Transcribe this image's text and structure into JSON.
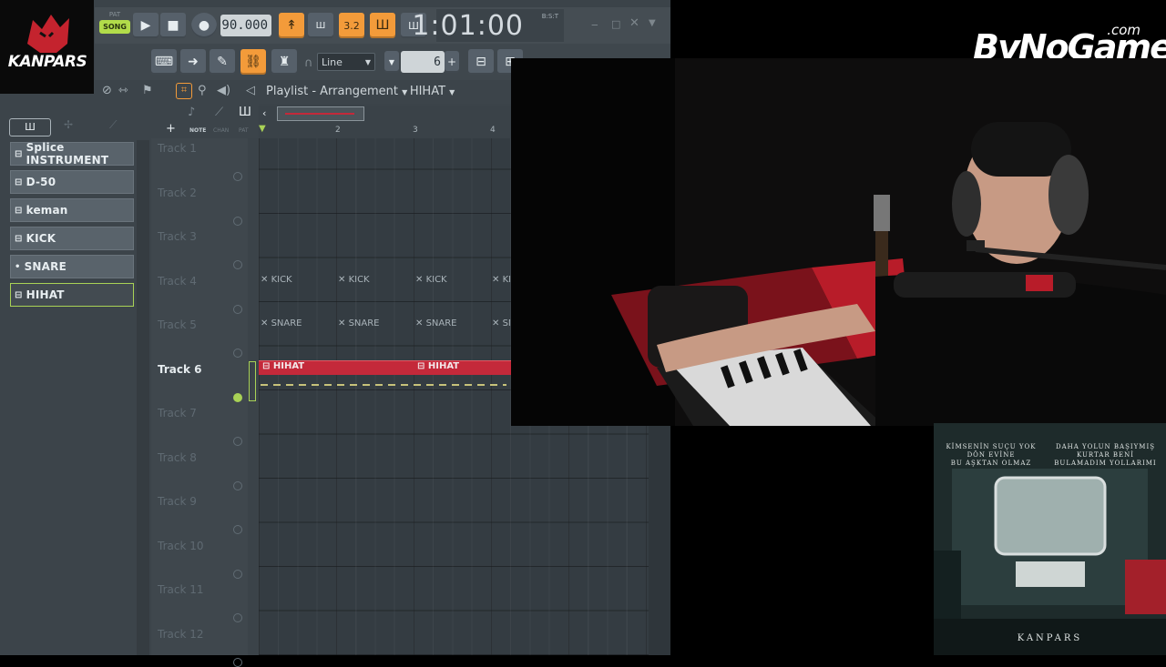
{
  "logo": {
    "text": "KANPARS"
  },
  "watermark": {
    "brand": "ByNoGame",
    "suffix": ".com"
  },
  "transport": {
    "mode_top": "PAT",
    "mode_bottom": "SONG",
    "tempo": "90.000",
    "time": "1:01:00",
    "time_label": "B:S:T",
    "btn_pattern_num": "3.2",
    "snap": "Line",
    "step": "6"
  },
  "playlist": {
    "title": "Playlist - Arrangement",
    "pattern": "HIHAT",
    "col_labels": [
      "NOTE",
      "CHAN",
      "PAT"
    ],
    "ruler": [
      "2",
      "3",
      "4"
    ]
  },
  "picker": {
    "items": [
      {
        "label": "Splice INSTRUMENT",
        "icon": "grid"
      },
      {
        "label": "D-50",
        "icon": "grid"
      },
      {
        "label": "keman",
        "icon": "grid"
      },
      {
        "label": "KICK",
        "icon": "grid"
      },
      {
        "label": "SNARE",
        "icon": "dot"
      },
      {
        "label": "HIHAT",
        "icon": "grid",
        "selected": true
      }
    ]
  },
  "tracks": [
    {
      "name": "Track 1"
    },
    {
      "name": "Track 2"
    },
    {
      "name": "Track 3"
    },
    {
      "name": "Track 4"
    },
    {
      "name": "Track 5"
    },
    {
      "name": "Track 6",
      "active": true
    },
    {
      "name": "Track 7"
    },
    {
      "name": "Track 8"
    },
    {
      "name": "Track 9"
    },
    {
      "name": "Track 10"
    },
    {
      "name": "Track 11"
    },
    {
      "name": "Track 12"
    }
  ],
  "clips": {
    "kick": "KICK",
    "snare": "SNARE",
    "hihat": "HIHAT"
  },
  "album": {
    "line_left": [
      "KİMSENİN SUÇU YOK",
      "DÖN EVİNE",
      "BU AŞKTAN OLMAZ"
    ],
    "line_right": [
      "DAHA YOLUN BAŞIYMIŞ",
      "KURTAR BENİ",
      "BULAMADIM YOLLARIMI"
    ],
    "artist": "KANPARS"
  },
  "colors": {
    "accent": "#f39b3a",
    "select": "#a9d256",
    "clip": "#c4293a",
    "logo_red": "#c4232e"
  }
}
